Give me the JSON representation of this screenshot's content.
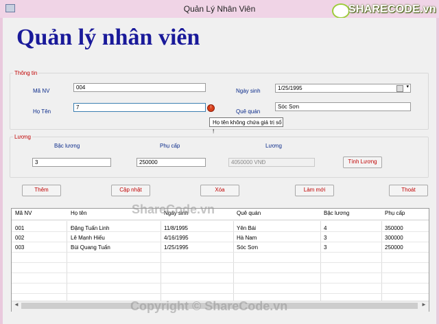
{
  "window": {
    "title": "Quản Lý Nhân Viên",
    "logo_text": "SHARECODE.vn"
  },
  "app_title": "Quản lý nhân viên",
  "info_group": {
    "label": "Thông tin",
    "ma_nv_label": "Mã NV",
    "ma_nv_value": "004",
    "ho_ten_label": "Họ Tên",
    "ho_ten_value": "7",
    "ngay_sinh_label": "Ngày sinh",
    "ngay_sinh_value": "1/25/1995",
    "que_quan_label": "Quê quán",
    "que_quan_value": "Sóc Sơn",
    "error_tooltip": "Họ tên không chứa giá trị số !"
  },
  "salary_group": {
    "label": "Lương",
    "bac_luong_label": "Bậc lương",
    "bac_luong_value": "3",
    "phu_cap_label": "Phụ cấp",
    "phu_cap_value": "250000",
    "luong_label": "Lương",
    "luong_value": "4050000 VNĐ",
    "calc_button": "Tính Lương"
  },
  "actions": {
    "add": "Thêm",
    "update": "Cập nhật",
    "delete": "Xóa",
    "refresh": "Làm mới",
    "exit": "Thoát"
  },
  "grid": {
    "columns": [
      "Mã NV",
      "Họ tên",
      "Ngày sinh",
      "Quê quán",
      "Bậc lương",
      "Phụ cấp"
    ],
    "rows": [
      [
        "001",
        "Đặng Tuấn Linh",
        "11/8/1995",
        "Yên Bái",
        "4",
        "350000"
      ],
      [
        "002",
        "Lê Mạnh Hiếu",
        "4/16/1995",
        "Hà Nam",
        "3",
        "300000"
      ],
      [
        "003",
        "Bùi Quang Tuấn",
        "1/25/1995",
        "Sóc Sơn",
        "3",
        "250000"
      ]
    ]
  },
  "watermarks": {
    "middle": "ShareCode.vn",
    "bottom": "Copyright © ShareCode.vn"
  },
  "colors": {
    "title_blue": "#1a1a9a",
    "group_red": "#c00000",
    "label_blue": "#0a2a8a",
    "logo_green": "#9dcc3a"
  }
}
